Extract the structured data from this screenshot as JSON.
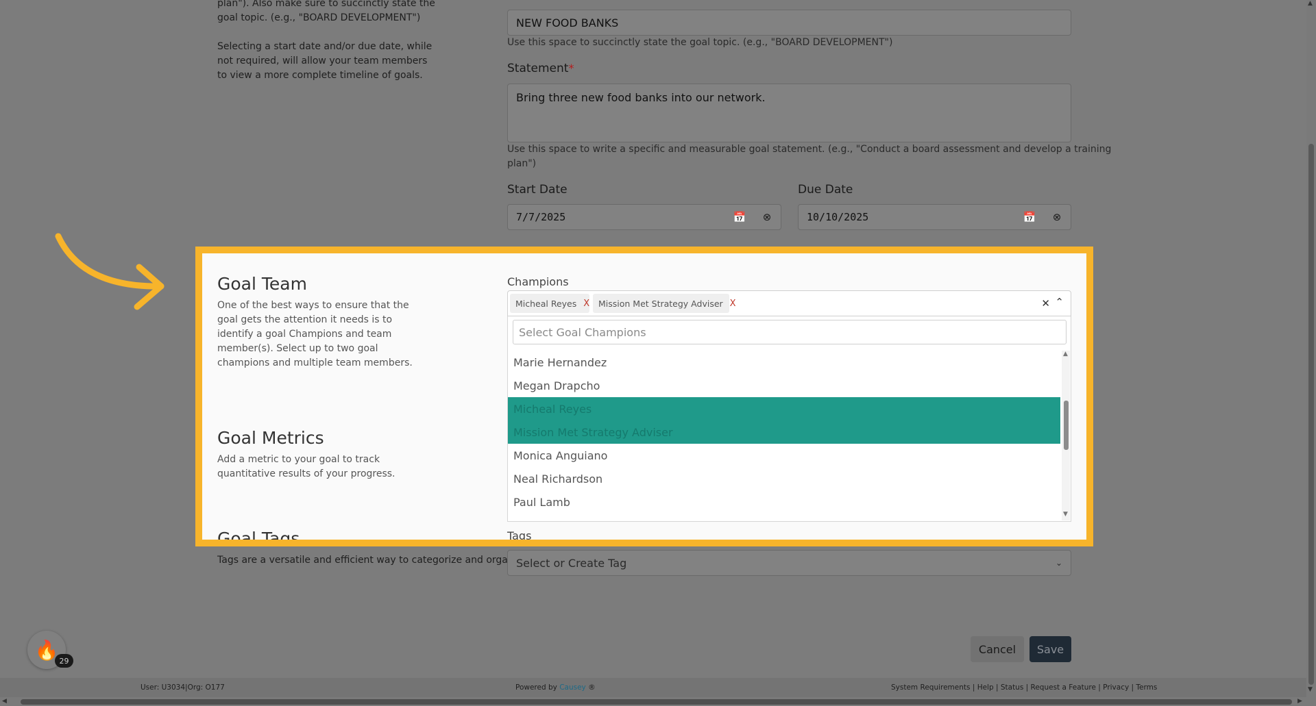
{
  "intro": {
    "text1": "plan\"). Also make sure to succinctly state the",
    "text2": "goal topic. (e.g., \"BOARD DEVELOPMENT\")",
    "text3": "Selecting a start date and/or due date, while",
    "text4": "not required, will allow your team members",
    "text5": "to view a more complete timeline of goals."
  },
  "topic": {
    "value": "NEW FOOD BANKS",
    "help": "Use this space to succinctly state the goal topic. (e.g., \"BOARD DEVELOPMENT\")"
  },
  "statement": {
    "label": "Statement",
    "required": "*",
    "value": "Bring three new food banks into our network.",
    "help1": "Use this space to write a specific and measurable goal statement. (e.g., \"Conduct a board assessment and develop a training",
    "help2": "plan\")"
  },
  "dates": {
    "start_label": "Start Date",
    "start_value": "7/7/2025",
    "due_label": "Due Date",
    "due_value": "10/10/2025"
  },
  "goal_team": {
    "title": "Goal Team",
    "desc": "One of the best ways to ensure that the goal gets the attention it needs is to identify a goal Champions and team member(s). Select up to two goal champions and multiple team members.",
    "champions_label": "Champions",
    "chips": [
      "Micheal Reyes",
      "Mission Met Strategy Adviser"
    ],
    "chip_remove": "X",
    "search_placeholder": "Select Goal Champions",
    "options": [
      "Marie Hernandez",
      "Megan Drapcho",
      "Micheal Reyes",
      "Mission Met Strategy Adviser",
      "Monica Anguiano",
      "Neal Richardson",
      "Paul Lamb"
    ]
  },
  "goal_metrics": {
    "title": "Goal Metrics",
    "desc": "Add a metric to your goal to track quantitative results of your progress."
  },
  "goal_tags": {
    "title": "Goal Tags",
    "desc": "Tags are a versatile and efficient way to categorize and organize information.",
    "label": "Tags",
    "placeholder": "Select or Create Tag"
  },
  "actions": {
    "cancel": "Cancel",
    "save": "Save"
  },
  "badge_count": "29",
  "footer": {
    "user": "User: U3034|Org: O177",
    "powered": "Powered by",
    "brand": "Causey",
    "reg": "®",
    "links": "System Requirements | Help | Status | Request a Feature | Privacy | Terms"
  },
  "colors": {
    "highlight": "#f7b42b",
    "selected": "#1f9a8a",
    "save_bg": "#1f2a35",
    "brand": "#3ba3c9"
  }
}
